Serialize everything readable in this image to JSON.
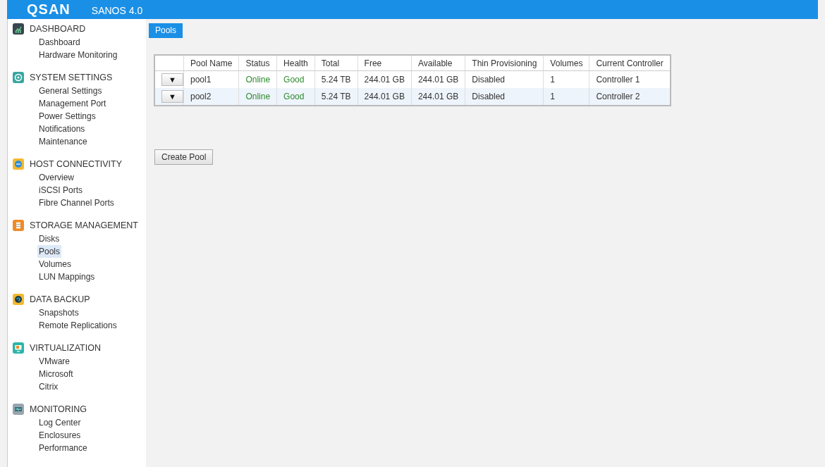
{
  "header": {
    "logo": "QSAN",
    "product": "SANOS 4.0"
  },
  "sidebar": {
    "groups": [
      {
        "title": "DASHBOARD",
        "kind": "dashboard",
        "items": [
          {
            "label": "Dashboard",
            "selected": false
          },
          {
            "label": "Hardware Monitoring",
            "selected": false
          }
        ]
      },
      {
        "title": "SYSTEM SETTINGS",
        "kind": "settings",
        "items": [
          {
            "label": "General Settings",
            "selected": false
          },
          {
            "label": "Management Port",
            "selected": false
          },
          {
            "label": "Power Settings",
            "selected": false
          },
          {
            "label": "Notifications",
            "selected": false
          },
          {
            "label": "Maintenance",
            "selected": false
          }
        ]
      },
      {
        "title": "HOST CONNECTIVITY",
        "kind": "connectivity",
        "items": [
          {
            "label": "Overview",
            "selected": false
          },
          {
            "label": "iSCSI Ports",
            "selected": false
          },
          {
            "label": "Fibre Channel Ports",
            "selected": false
          }
        ]
      },
      {
        "title": "STORAGE MANAGEMENT",
        "kind": "storage",
        "items": [
          {
            "label": "Disks",
            "selected": false
          },
          {
            "label": "Pools",
            "selected": true
          },
          {
            "label": "Volumes",
            "selected": false
          },
          {
            "label": "LUN Mappings",
            "selected": false
          }
        ]
      },
      {
        "title": "DATA BACKUP",
        "kind": "backup",
        "items": [
          {
            "label": "Snapshots",
            "selected": false
          },
          {
            "label": "Remote Replications",
            "selected": false
          }
        ]
      },
      {
        "title": "VIRTUALIZATION",
        "kind": "virtualization",
        "items": [
          {
            "label": "VMware",
            "selected": false
          },
          {
            "label": "Microsoft",
            "selected": false
          },
          {
            "label": "Citrix",
            "selected": false
          }
        ]
      },
      {
        "title": "MONITORING",
        "kind": "monitoring",
        "items": [
          {
            "label": "Log Center",
            "selected": false
          },
          {
            "label": "Enclosures",
            "selected": false
          },
          {
            "label": "Performance",
            "selected": false
          }
        ]
      }
    ]
  },
  "tabs": [
    {
      "label": "Pools",
      "selected": true
    }
  ],
  "table": {
    "columns": [
      {
        "kind": "action"
      },
      {
        "label": "Pool Name",
        "kind": "text"
      },
      {
        "label": "Status",
        "kind": "ok"
      },
      {
        "label": "Health",
        "kind": "ok"
      },
      {
        "label": "Total",
        "kind": "text"
      },
      {
        "label": "Free",
        "kind": "text"
      },
      {
        "label": "Available",
        "kind": "text"
      },
      {
        "label": "Thin Provisioning",
        "kind": "text"
      },
      {
        "label": "Volumes",
        "kind": "text"
      },
      {
        "label": "Current Controller",
        "kind": "text"
      }
    ],
    "rows": [
      {
        "cells": [
          "▼",
          "pool1",
          "Online",
          "Good",
          "5.24 TB",
          "244.01 GB",
          "244.01 GB",
          "Disabled",
          "1",
          "Controller 1"
        ]
      },
      {
        "cells": [
          "▼",
          "pool2",
          "Online",
          "Good",
          "5.24 TB",
          "244.01 GB",
          "244.01 GB",
          "Disabled",
          "1",
          "Controller 2"
        ]
      }
    ]
  },
  "buttons": [
    "Create Pool"
  ]
}
